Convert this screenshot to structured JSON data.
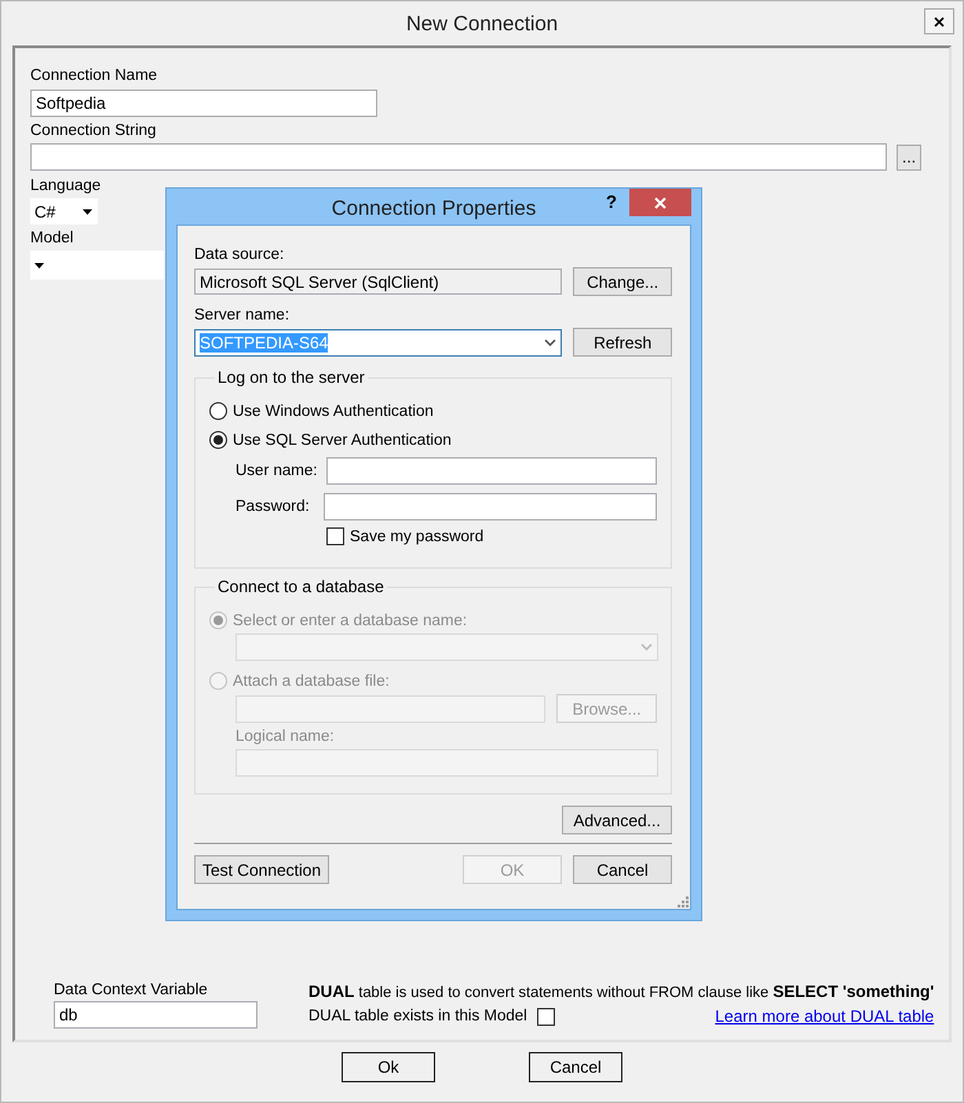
{
  "window": {
    "title": "New Connection"
  },
  "connection_name": {
    "label": "Connection Name",
    "value": "Softpedia"
  },
  "connection_string": {
    "label": "Connection String",
    "button": "..."
  },
  "language": {
    "label": "Language",
    "value": "C#"
  },
  "model": {
    "label": "Model"
  },
  "data_context_variable": {
    "label": "Data Context Variable",
    "value": "db"
  },
  "dual": {
    "description": "**DUAL**  table is used to convert statements without FROM clause like **SELECT 'something'**",
    "checkbox_label": "DUAL table exists in this Model",
    "checked": false,
    "link": "Learn more about DUAL table"
  },
  "buttons": [
    "Ok",
    "Cancel"
  ],
  "dialog": {
    "title": "Connection Properties",
    "help": "?",
    "data_source": {
      "label": "Data source:",
      "value": "Microsoft SQL Server (SqlClient)",
      "button": "Change..."
    },
    "server_name": {
      "label": "Server name:",
      "value": "SOFTPEDIA-S64",
      "value_selected": true,
      "button": "Refresh"
    },
    "logon": {
      "title": "Log on to the server",
      "disabled": false,
      "options": [
        {
          "label": "Use Windows Authentication",
          "selected": false
        },
        {
          "label": "Use SQL Server Authentication",
          "selected": true
        }
      ],
      "user_name_label": "User name:",
      "password_label": "Password:",
      "save_password": {
        "label": "Save my password",
        "checked": false
      }
    },
    "database": {
      "title": "Connect to a database",
      "disabled": true,
      "options": [
        {
          "label": "Select or enter a database name:",
          "selected": true
        },
        {
          "label": "Attach a database file:",
          "selected": false
        }
      ],
      "browse_button": "Browse...",
      "logical_name_label": "Logical name:"
    },
    "advanced_button": "Advanced...",
    "footer_buttons": [
      {
        "label": "Test Connection",
        "disabled": false
      },
      {
        "label": "OK",
        "disabled": true
      },
      {
        "label": "Cancel",
        "disabled": false
      }
    ]
  }
}
